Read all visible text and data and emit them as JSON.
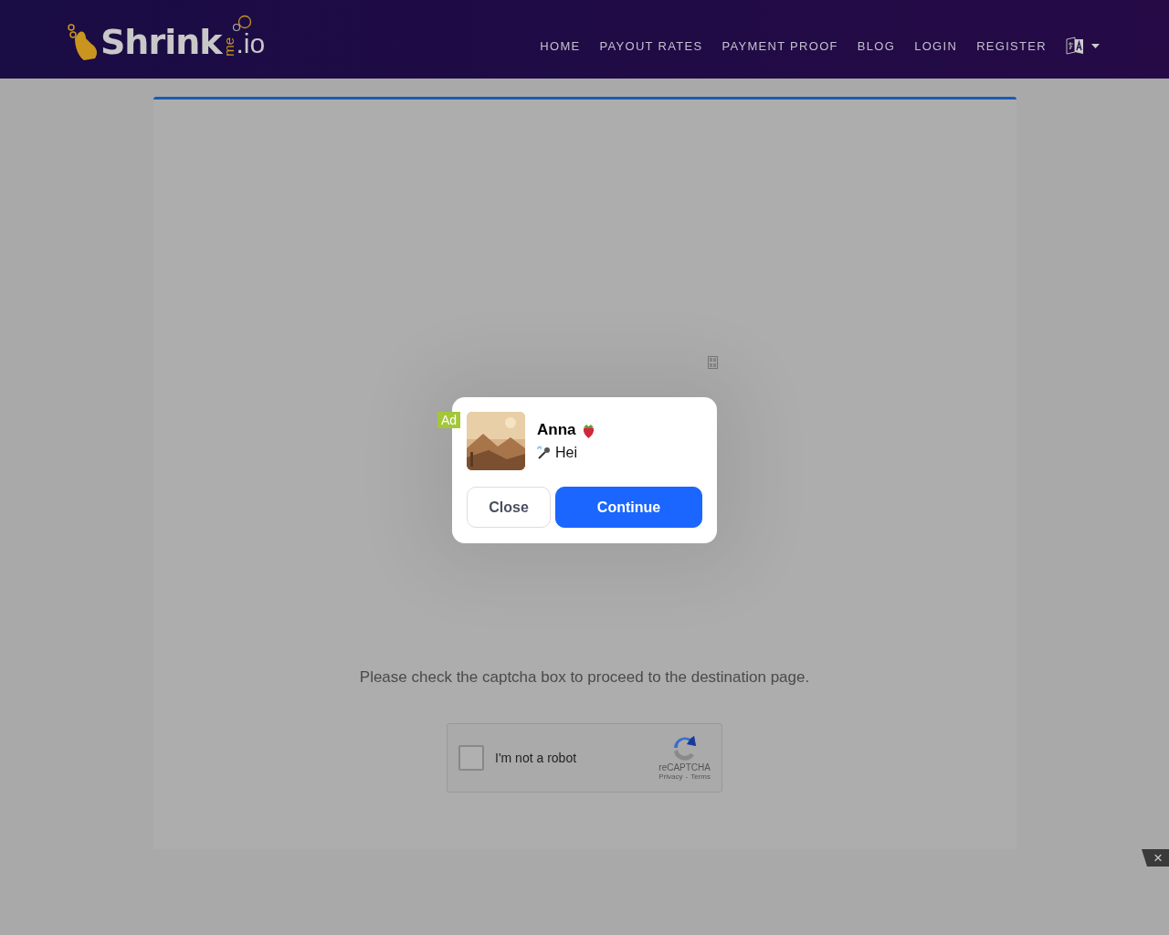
{
  "logo": {
    "parts": [
      "Shrink",
      "me",
      ".io"
    ]
  },
  "nav": {
    "items": [
      {
        "label": "HOME"
      },
      {
        "label": "PAYOUT RATES"
      },
      {
        "label": "PAYMENT PROOF"
      },
      {
        "label": "BLOG"
      },
      {
        "label": "LOGIN"
      },
      {
        "label": "REGISTER"
      }
    ]
  },
  "message": "Please check the captcha box to proceed to the destination page.",
  "captcha": {
    "label": "I'm not a robot",
    "checked": false,
    "brand": "reCAPTCHA",
    "links": [
      "Privacy",
      "Terms"
    ],
    "separator": "-"
  },
  "ad_popup": {
    "badge": "Ad",
    "name": "Anna",
    "text": "Hei",
    "buttons": [
      {
        "label": "Close",
        "kind": "secondary"
      },
      {
        "label": "Continue",
        "kind": "primary"
      }
    ]
  },
  "bottom_bar": {
    "close": "×"
  }
}
